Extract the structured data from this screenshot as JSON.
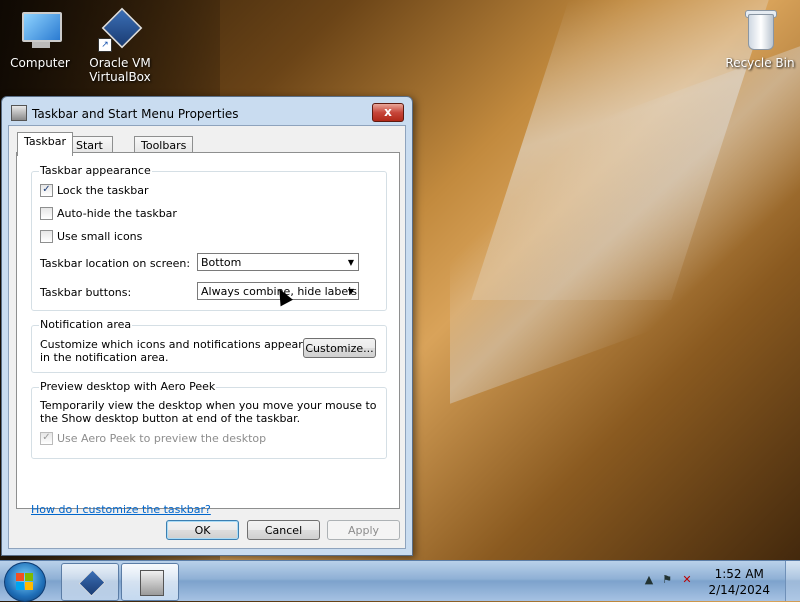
{
  "desktop": {
    "icons": [
      {
        "label_line1": "Computer",
        "label_line2": ""
      },
      {
        "label_line1": "Oracle VM",
        "label_line2": "VirtualBox"
      },
      {
        "label_line1": "Recycle Bin",
        "label_line2": ""
      }
    ]
  },
  "window": {
    "title": "Taskbar and Start Menu Properties",
    "close_label": "x",
    "tabs": [
      {
        "label": "Taskbar",
        "active": true
      },
      {
        "label": "Start Menu",
        "active": false
      },
      {
        "label": "Toolbars",
        "active": false
      }
    ],
    "appearance": {
      "label": "Taskbar appearance",
      "lock": {
        "label": "Lock the taskbar",
        "checked": true
      },
      "autohide": {
        "label": "Auto-hide the taskbar",
        "checked": false
      },
      "small_icons": {
        "label": "Use small icons",
        "checked": false
      },
      "location_label": "Taskbar location on screen:",
      "location_value": "Bottom",
      "buttons_label": "Taskbar buttons:",
      "buttons_value": "Always combine, hide labels"
    },
    "notification": {
      "label": "Notification area",
      "text": "Customize which icons and notifications appear in the notification area.",
      "customize_button": "Customize..."
    },
    "aero_peek": {
      "label": "Preview desktop with Aero Peek",
      "text": "Temporarily view the desktop when you move your mouse to the Show desktop button at end of the taskbar.",
      "checkbox_label": "Use Aero Peek to preview the desktop",
      "checked": true,
      "enabled": false
    },
    "help_link": "How do I customize the taskbar?",
    "buttons": {
      "ok": "OK",
      "cancel": "Cancel",
      "apply": "Apply"
    }
  },
  "taskbar": {
    "clock_time": "1:52 AM",
    "clock_date": "2/14/2024"
  },
  "colors": {
    "accent": "#3c7fb1",
    "link": "#0066cc",
    "close_button": "#c7463a"
  },
  "icons": [
    "computer-icon",
    "virtualbox-icon",
    "recycle-bin-icon",
    "start-orb-icon",
    "flag-icon",
    "network-icon",
    "volume-muted-icon",
    "up-arrow-icon"
  ]
}
